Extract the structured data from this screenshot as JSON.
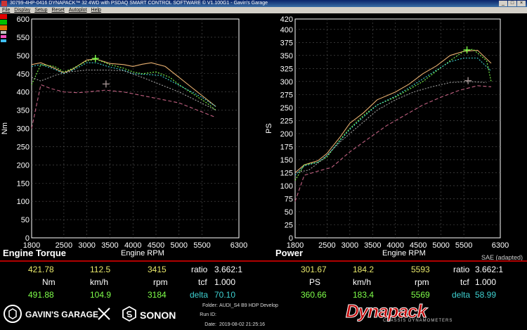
{
  "window": {
    "title": "30799-4HP-0416 DYNAPACK™ 32 4WD with PSDAQ SMART CONTROL SOFTWARE © V1.100G1 - Gavin's Garage",
    "menu": [
      "File",
      "Display",
      "Setup",
      "Reset",
      "Autoplot",
      "Help"
    ]
  },
  "swatch_colors": [
    "#e00000",
    "#00c000",
    "#e07000",
    "#c0c0c0",
    "#ff4fc0",
    "#40c0ff"
  ],
  "chart_data": [
    {
      "type": "line",
      "title": "Engine Torque",
      "xlabel": "Engine RPM",
      "ylabel": "Nm",
      "xlim": [
        1800,
        6300
      ],
      "ylim": [
        0,
        600
      ],
      "xticks": [
        1800,
        2500,
        3000,
        3500,
        4000,
        4500,
        5000,
        5500,
        6300
      ],
      "yticks": [
        0,
        50,
        100,
        150,
        200,
        250,
        300,
        350,
        400,
        450,
        500,
        550,
        600
      ],
      "grid": true,
      "series": [
        {
          "color": "#e8b070",
          "style": "solid",
          "points": [
            [
              1800,
              475
            ],
            [
              2000,
              480
            ],
            [
              2300,
              465
            ],
            [
              2500,
              452
            ],
            [
              2700,
              463
            ],
            [
              3000,
              488
            ],
            [
              3200,
              490
            ],
            [
              3500,
              478
            ],
            [
              3800,
              475
            ],
            [
              4000,
              470
            ],
            [
              4200,
              476
            ],
            [
              4400,
              480
            ],
            [
              4700,
              470
            ],
            [
              5000,
              440
            ],
            [
              5300,
              410
            ],
            [
              5600,
              380
            ],
            [
              5800,
              360
            ]
          ]
        },
        {
          "color": "#7fff4a",
          "style": "dotted",
          "points": [
            [
              1800,
              420
            ],
            [
              2000,
              475
            ],
            [
              2300,
              470
            ],
            [
              2500,
              455
            ],
            [
              2700,
              465
            ],
            [
              3000,
              485
            ],
            [
              3200,
              490
            ],
            [
              3500,
              475
            ],
            [
              3800,
              465
            ],
            [
              4000,
              455
            ],
            [
              4200,
              450
            ],
            [
              4500,
              455
            ],
            [
              4800,
              440
            ],
            [
              5000,
              420
            ],
            [
              5300,
              395
            ],
            [
              5600,
              370
            ],
            [
              5800,
              350
            ]
          ]
        },
        {
          "color": "#3ed0d0",
          "style": "dotted",
          "points": [
            [
              1800,
              470
            ],
            [
              2000,
              475
            ],
            [
              2300,
              462
            ],
            [
              2500,
              450
            ],
            [
              2700,
              460
            ],
            [
              3000,
              480
            ],
            [
              3200,
              480
            ],
            [
              3500,
              468
            ],
            [
              3800,
              460
            ],
            [
              4000,
              450
            ],
            [
              4300,
              448
            ],
            [
              4600,
              445
            ],
            [
              4900,
              425
            ],
            [
              5200,
              405
            ],
            [
              5500,
              385
            ],
            [
              5800,
              360
            ]
          ]
        },
        {
          "color": "#c06080",
          "style": "dashed",
          "points": [
            [
              1800,
              300
            ],
            [
              2000,
              420
            ],
            [
              2200,
              410
            ],
            [
              2500,
              400
            ],
            [
              2800,
              398
            ],
            [
              3000,
              400
            ],
            [
              3400,
              405
            ],
            [
              3800,
              400
            ],
            [
              4200,
              390
            ],
            [
              4600,
              380
            ],
            [
              5000,
              370
            ],
            [
              5400,
              350
            ],
            [
              5800,
              330
            ]
          ]
        },
        {
          "color": "#a0a0a0",
          "style": "dotted",
          "points": [
            [
              1800,
              440
            ],
            [
              2000,
              430
            ],
            [
              2300,
              445
            ],
            [
              2600,
              455
            ],
            [
              3000,
              460
            ],
            [
              3400,
              460
            ],
            [
              3800,
              458
            ],
            [
              4200,
              440
            ],
            [
              4600,
              420
            ],
            [
              5000,
              400
            ],
            [
              5400,
              375
            ],
            [
              5800,
              350
            ]
          ]
        }
      ],
      "markers": [
        {
          "x": 3184,
          "y": 491.88,
          "color": "#7fff4a"
        },
        {
          "x": 3415,
          "y": 421.78,
          "color": "#a09090"
        }
      ]
    },
    {
      "type": "line",
      "title": "Power",
      "xlabel": "Engine RPM",
      "ylabel": "PS",
      "xlim": [
        1800,
        6300
      ],
      "ylim": [
        0,
        420
      ],
      "xticks": [
        1800,
        2500,
        3000,
        3500,
        4000,
        4500,
        5000,
        5500,
        6300
      ],
      "yticks": [
        0,
        25,
        50,
        75,
        100,
        125,
        150,
        175,
        200,
        225,
        250,
        275,
        300,
        325,
        350,
        375,
        400,
        420
      ],
      "grid": true,
      "series": [
        {
          "color": "#e8b070",
          "style": "solid",
          "points": [
            [
              1800,
              125
            ],
            [
              2000,
              140
            ],
            [
              2300,
              148
            ],
            [
              2500,
              162
            ],
            [
              2800,
              195
            ],
            [
              3000,
              220
            ],
            [
              3300,
              240
            ],
            [
              3600,
              265
            ],
            [
              4000,
              280
            ],
            [
              4300,
              295
            ],
            [
              4600,
              315
            ],
            [
              4900,
              330
            ],
            [
              5200,
              350
            ],
            [
              5500,
              358
            ],
            [
              5800,
              360
            ],
            [
              6100,
              335
            ]
          ]
        },
        {
          "color": "#7fff4a",
          "style": "dotted",
          "points": [
            [
              1800,
              110
            ],
            [
              2000,
              140
            ],
            [
              2300,
              145
            ],
            [
              2500,
              155
            ],
            [
              2800,
              190
            ],
            [
              3000,
              210
            ],
            [
              3300,
              235
            ],
            [
              3600,
              255
            ],
            [
              4000,
              270
            ],
            [
              4300,
              285
            ],
            [
              4600,
              300
            ],
            [
              4900,
              320
            ],
            [
              5200,
              340
            ],
            [
              5500,
              358
            ],
            [
              5700,
              362
            ],
            [
              6000,
              340
            ],
            [
              6100,
              300
            ]
          ]
        },
        {
          "color": "#3ed0d0",
          "style": "dotted",
          "points": [
            [
              1800,
              120
            ],
            [
              2000,
              138
            ],
            [
              2300,
              145
            ],
            [
              2500,
              158
            ],
            [
              2800,
              188
            ],
            [
              3000,
              208
            ],
            [
              3300,
              232
            ],
            [
              3600,
              255
            ],
            [
              4000,
              272
            ],
            [
              4300,
              288
            ],
            [
              4600,
              305
            ],
            [
              4900,
              322
            ],
            [
              5200,
              338
            ],
            [
              5500,
              345
            ],
            [
              5800,
              345
            ],
            [
              6100,
              320
            ]
          ]
        },
        {
          "color": "#c06080",
          "style": "dashed",
          "points": [
            [
              1800,
              70
            ],
            [
              2000,
              120
            ],
            [
              2300,
              128
            ],
            [
              2600,
              135
            ],
            [
              3000,
              165
            ],
            [
              3400,
              190
            ],
            [
              3800,
              215
            ],
            [
              4200,
              235
            ],
            [
              4600,
              255
            ],
            [
              5000,
              270
            ],
            [
              5400,
              283
            ],
            [
              5800,
              292
            ],
            [
              6100,
              290
            ]
          ]
        },
        {
          "color": "#a0a0a0",
          "style": "dotted",
          "points": [
            [
              1800,
              125
            ],
            [
              2100,
              130
            ],
            [
              2400,
              150
            ],
            [
              2800,
              185
            ],
            [
              3200,
              215
            ],
            [
              3600,
              245
            ],
            [
              4000,
              265
            ],
            [
              4400,
              280
            ],
            [
              4800,
              290
            ],
            [
              5200,
              298
            ],
            [
              5600,
              300
            ],
            [
              6000,
              298
            ]
          ]
        }
      ],
      "markers": [
        {
          "x": 5569,
          "y": 360.66,
          "color": "#7fff4a"
        },
        {
          "x": 5593,
          "y": 301.67,
          "color": "#a09090"
        }
      ]
    }
  ],
  "panels": {
    "torque": {
      "title": "Engine Torque",
      "xlabel": "Engine RPM"
    },
    "power": {
      "title": "Power",
      "xlabel": "Engine RPM",
      "note": "SAE (adapted)"
    }
  },
  "readouts": {
    "torque": {
      "row1": {
        "v1": "421.78",
        "v2": "112.5",
        "v3": "3415",
        "label": "ratio",
        "val": "3.662:1"
      },
      "units": {
        "u1": "Nm",
        "u2": "km/h",
        "u3": "rpm",
        "label": "tcf",
        "val": "1.000"
      },
      "row3": {
        "v1": "491.88",
        "v2": "104.9",
        "v3": "3184",
        "label": "delta",
        "val": "70.10"
      }
    },
    "power": {
      "row1": {
        "v1": "301.67",
        "v2": "184.2",
        "v3": "5593",
        "label": "ratio",
        "val": "3.662:1"
      },
      "units": {
        "u1": "PS",
        "u2": "km/h",
        "u3": "rpm",
        "label": "tcf",
        "val": "1.000"
      },
      "row3": {
        "v1": "360.66",
        "v2": "183.4",
        "v3": "5569",
        "label": "delta",
        "val": "58.99"
      }
    }
  },
  "footer": {
    "brand1": "GAVIN'S GARAGE",
    "brand2": "SONON",
    "folder_label": "Folder:",
    "folder_value": "AUDI_S4 B9 HDP Develop",
    "runid_label": "Run ID:",
    "runid_value": "",
    "date_label": "Date:",
    "date_value": "2019-08-02 21:25:16",
    "logo": "Dynapack",
    "logo_sub": "CHASSIS DYNAMOMETERS"
  }
}
